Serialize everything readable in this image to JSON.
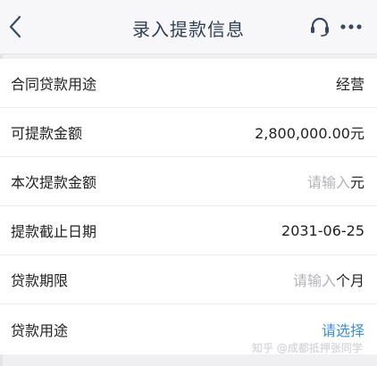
{
  "header": {
    "title": "录入提款信息"
  },
  "form": {
    "rows": [
      {
        "label": "合同贷款用途",
        "value": "经营"
      },
      {
        "label": "可提款金额",
        "value": "2,800,000.00元"
      },
      {
        "label": "本次提款金额",
        "placeholder": "请输入",
        "unit": "元"
      },
      {
        "label": "提款截止日期",
        "value": "2031-06-25"
      },
      {
        "label": "贷款期限",
        "placeholder": "请输入",
        "unit": "个月"
      },
      {
        "label": "贷款用途",
        "action": "请选择"
      }
    ]
  },
  "watermark": "知乎 @成都抵押张同学",
  "colors": {
    "title": "#2f3f53",
    "link": "#3d8fd6",
    "placeholder": "#b4b4b8"
  },
  "icons": [
    "back-icon",
    "headset-icon",
    "more-icon"
  ]
}
